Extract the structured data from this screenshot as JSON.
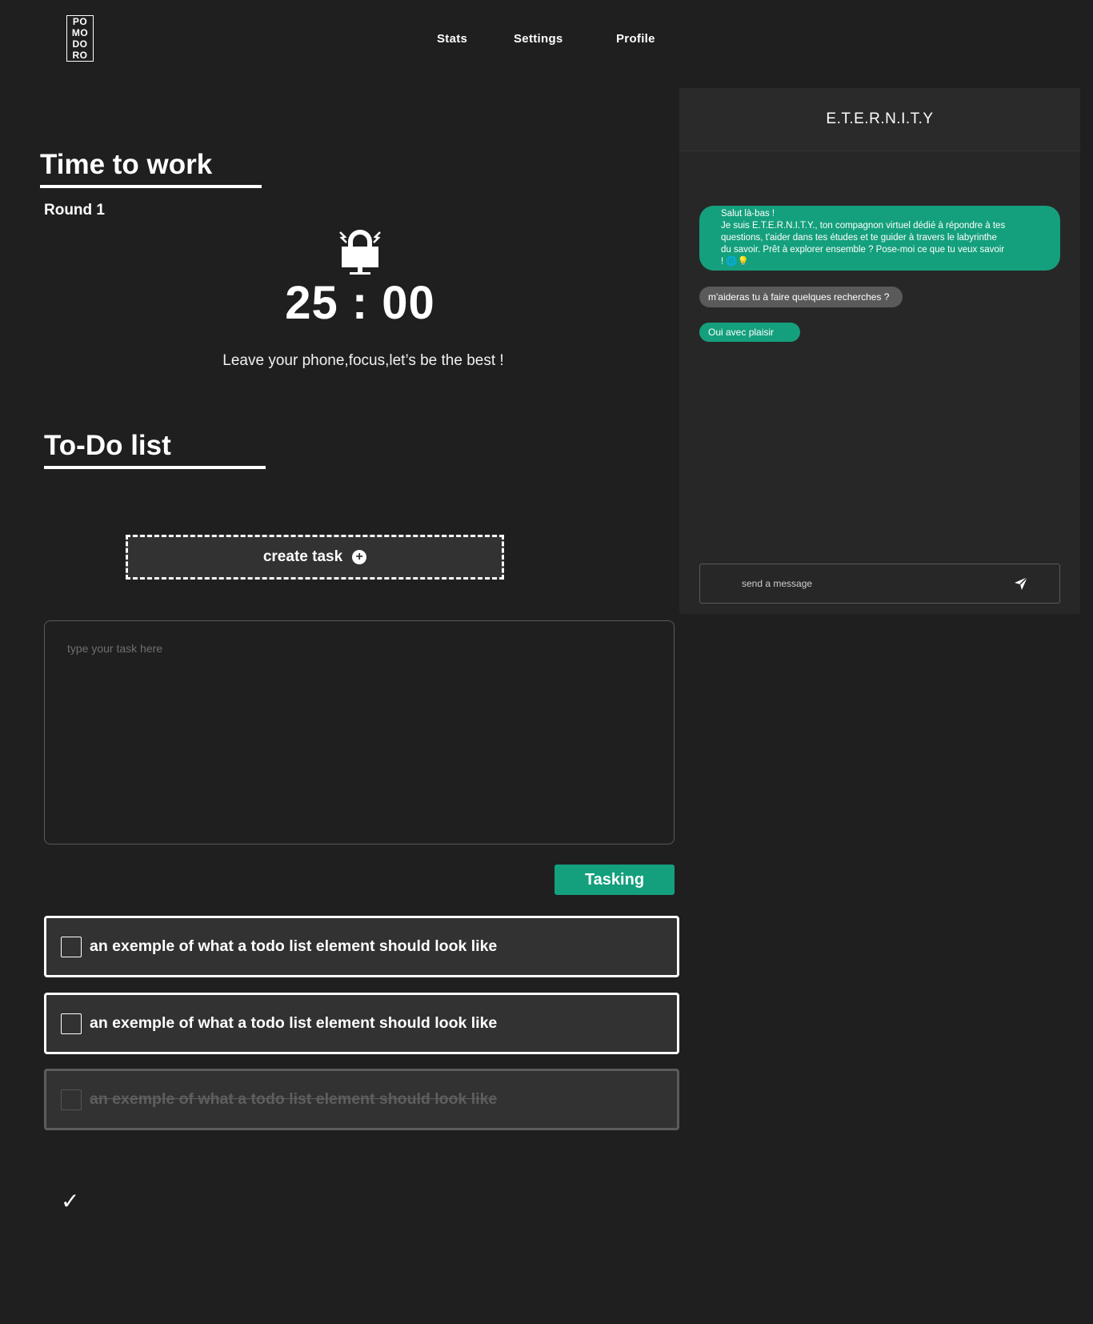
{
  "header": {
    "logo_lines": [
      "PO",
      "MO",
      "DO",
      "RO"
    ],
    "nav": {
      "stats": "Stats",
      "settings": "Settings",
      "profile": "Profile"
    }
  },
  "timer_section": {
    "title": "Time to work",
    "round": "Round 1",
    "time": "25 : 00",
    "motto": "Leave your phone,focus,let’s be the best !",
    "icon": "lock-alarm-icon"
  },
  "todo_section": {
    "title": "To-Do list",
    "create_task_label": "create task",
    "task_placeholder": "type your task here",
    "tasking_label": "Tasking",
    "items": [
      {
        "text": "an exemple of what a todo list element should look like",
        "done": false
      },
      {
        "text": "an exemple of what a todo list element should look like",
        "done": false
      },
      {
        "text": "an exemple of what a todo list element should look like",
        "done": true
      }
    ],
    "checkmark": "✓"
  },
  "chat": {
    "title": "E.T.E.R.N.I.T.Y",
    "messages": [
      {
        "from": "bot",
        "lines": [
          "Salut là-bas !",
          "Je suis E.T.E.R.N.I.T.Y., ton compagnon virtuel dédié à répondre à tes",
          "questions, t'aider dans tes études et te guider à travers le labyrinthe",
          "du savoir. Prêt à explorer ensemble ? Pose-moi ce que tu veux savoir",
          "! 🌐💡"
        ]
      },
      {
        "from": "user",
        "text": "m'aideras tu à faire quelques recherches ?"
      },
      {
        "from": "bot",
        "text": "Oui avec plaisir"
      }
    ],
    "input_placeholder": "send a message"
  },
  "colors": {
    "background": "#1f1f1f",
    "panel": "#272727",
    "accent": "#14a07c",
    "user_bubble": "#5a5a5a"
  }
}
